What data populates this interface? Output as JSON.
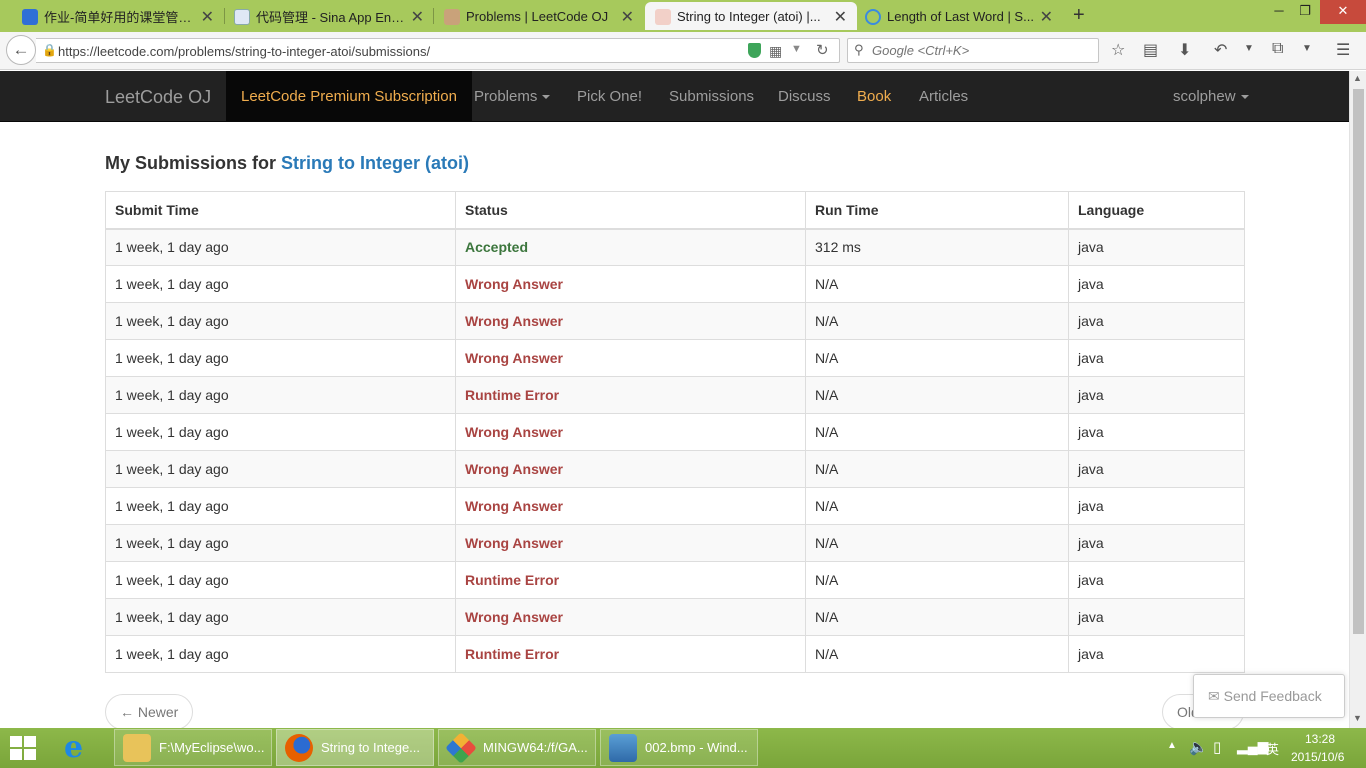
{
  "browser": {
    "tabs": [
      {
        "title": "作业-简单好用的课堂管理...",
        "active": false
      },
      {
        "title": "代码管理 - Sina App Eng...",
        "active": false
      },
      {
        "title": "Problems | LeetCode OJ",
        "active": false
      },
      {
        "title": "String to Integer (atoi) |...",
        "active": true
      },
      {
        "title": "Length of Last Word | S...",
        "active": false
      }
    ],
    "new_tab": "+",
    "url": "https://leetcode.com/problems/string-to-integer-atoi/submissions/",
    "search_placeholder": "Google <Ctrl+K>"
  },
  "site": {
    "brand": "LeetCode OJ",
    "premium": "LeetCode Premium Subscription",
    "nav": {
      "problems": "Problems",
      "pick_one": "Pick One!",
      "submissions": "Submissions",
      "discuss": "Discuss",
      "book": "Book",
      "articles": "Articles",
      "user": "scolphew"
    }
  },
  "main": {
    "heading_prefix": "My Submissions for ",
    "problem_title": "String to Integer (atoi)",
    "columns": [
      "Submit Time",
      "Status",
      "Run Time",
      "Language"
    ],
    "rows": [
      {
        "time": "1 week, 1 day ago",
        "status": "Accepted",
        "runtime": "312 ms",
        "lang": "java"
      },
      {
        "time": "1 week, 1 day ago",
        "status": "Wrong Answer",
        "runtime": "N/A",
        "lang": "java"
      },
      {
        "time": "1 week, 1 day ago",
        "status": "Wrong Answer",
        "runtime": "N/A",
        "lang": "java"
      },
      {
        "time": "1 week, 1 day ago",
        "status": "Wrong Answer",
        "runtime": "N/A",
        "lang": "java"
      },
      {
        "time": "1 week, 1 day ago",
        "status": "Runtime Error",
        "runtime": "N/A",
        "lang": "java"
      },
      {
        "time": "1 week, 1 day ago",
        "status": "Wrong Answer",
        "runtime": "N/A",
        "lang": "java"
      },
      {
        "time": "1 week, 1 day ago",
        "status": "Wrong Answer",
        "runtime": "N/A",
        "lang": "java"
      },
      {
        "time": "1 week, 1 day ago",
        "status": "Wrong Answer",
        "runtime": "N/A",
        "lang": "java"
      },
      {
        "time": "1 week, 1 day ago",
        "status": "Wrong Answer",
        "runtime": "N/A",
        "lang": "java"
      },
      {
        "time": "1 week, 1 day ago",
        "status": "Runtime Error",
        "runtime": "N/A",
        "lang": "java"
      },
      {
        "time": "1 week, 1 day ago",
        "status": "Wrong Answer",
        "runtime": "N/A",
        "lang": "java"
      },
      {
        "time": "1 week, 1 day ago",
        "status": "Runtime Error",
        "runtime": "N/A",
        "lang": "java"
      }
    ],
    "pager": {
      "newer": "← Newer",
      "older": "Old"
    },
    "feedback": "Send Feedback"
  },
  "taskbar": {
    "tasks": [
      "F:\\MyEclipse\\wo...",
      "String to Intege...",
      "MINGW64:/f/GA...",
      "002.bmp - Wind..."
    ],
    "ime": "英",
    "time": "13:28",
    "date": "2015/10/6"
  },
  "colors": {
    "accepted": "#3c763d",
    "error": "#a94442",
    "navbar": "#222222",
    "premium": "#f0ad4e",
    "link": "#2a7ab8",
    "taskbar": "#8db84a"
  }
}
